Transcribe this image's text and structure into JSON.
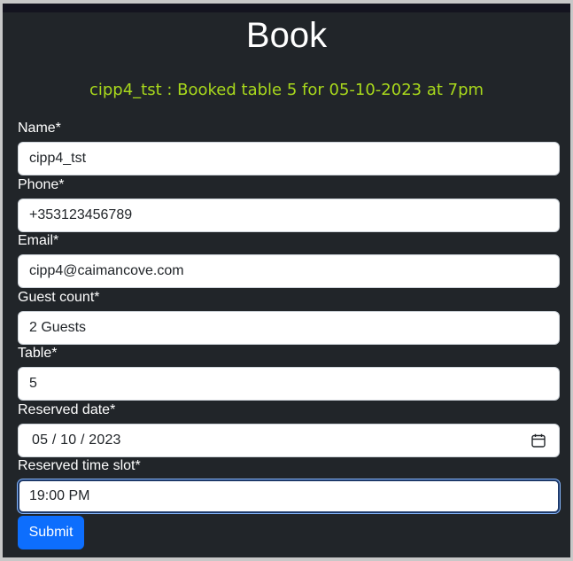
{
  "page": {
    "title": "Book",
    "status_message": "cipp4_tst : Booked table 5 for 05-10-2023 at 7pm"
  },
  "form": {
    "name": {
      "label": "Name*",
      "value": "cipp4_tst"
    },
    "phone": {
      "label": "Phone*",
      "value": "+353123456789"
    },
    "email": {
      "label": "Email*",
      "value": "cipp4@caimancove.com"
    },
    "guest_count": {
      "label": "Guest count*",
      "value": "2 Guests"
    },
    "table": {
      "label": "Table*",
      "value": "5"
    },
    "reserved_date": {
      "label": "Reserved date*",
      "value": "05 / 10 / 2023",
      "icon": "calendar-icon"
    },
    "reserved_time": {
      "label": "Reserved time slot*",
      "value": "19:00 PM"
    },
    "submit_label": "Submit"
  },
  "colors": {
    "background": "#212529",
    "status_text": "#a8d81c",
    "submit_button": "#0d6efd",
    "focus_border": "#1e3a6a"
  }
}
